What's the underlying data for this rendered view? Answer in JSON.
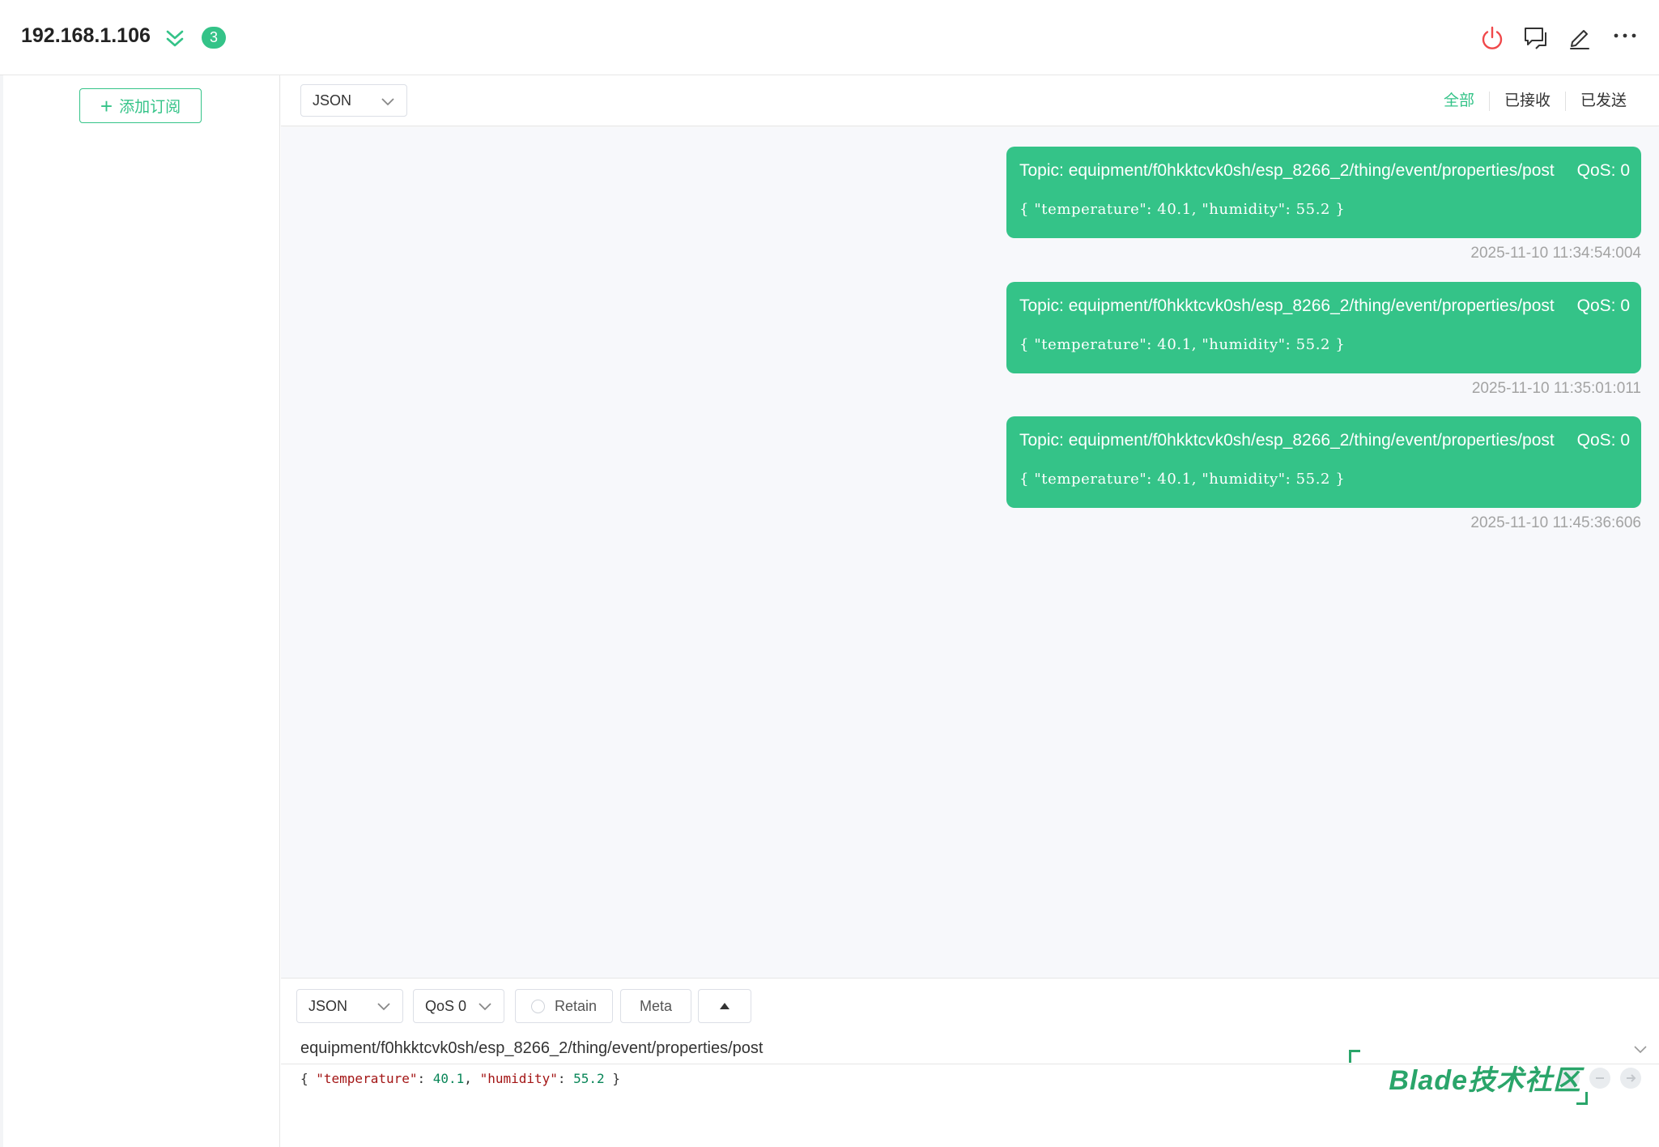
{
  "header": {
    "host": "192.168.1.106",
    "badge_count": "3",
    "icons": [
      "power-icon",
      "chat-window-icon",
      "edit-icon",
      "more-icon"
    ]
  },
  "sidebar": {
    "add_subscription_label": "添加订阅"
  },
  "toolbar": {
    "format": "JSON",
    "filters": [
      {
        "label": "全部",
        "active": true
      },
      {
        "label": "已接收",
        "active": false
      },
      {
        "label": "已发送",
        "active": false
      }
    ]
  },
  "messages": [
    {
      "topic": "Topic: equipment/f0hkktcvk0sh/esp_8266_2/thing/event/properties/post",
      "qos": "QoS: 0",
      "payload": "{ \"temperature\": 40.1, \"humidity\": 55.2 }",
      "time": "2025-11-10 11:34:54:004"
    },
    {
      "topic": "Topic: equipment/f0hkktcvk0sh/esp_8266_2/thing/event/properties/post",
      "qos": "QoS: 0",
      "payload": "{ \"temperature\": 40.1, \"humidity\": 55.2 }",
      "time": "2025-11-10 11:35:01:011"
    },
    {
      "topic": "Topic: equipment/f0hkktcvk0sh/esp_8266_2/thing/event/properties/post",
      "qos": "QoS: 0",
      "payload": "{ \"temperature\": 40.1, \"humidity\": 55.2 }",
      "time": "2025-11-10 11:45:36:606"
    }
  ],
  "publish": {
    "format": "JSON",
    "qos": "QoS 0",
    "retain_label": "Retain",
    "meta_label": "Meta",
    "topic": "equipment/f0hkktcvk0sh/esp_8266_2/thing/event/properties/post",
    "payload": {
      "open": "{ ",
      "key1": "\"temperature\"",
      "sep1": ": ",
      "val1": "40.1",
      "comma": ", ",
      "key2": "\"humidity\"",
      "sep2": ": ",
      "val2": "55.2",
      "close": " }"
    }
  },
  "watermark": "Blade技术社区",
  "colors": {
    "accent": "#34c388",
    "danger": "#f0484a",
    "timestamp": "#a3a3a3"
  }
}
